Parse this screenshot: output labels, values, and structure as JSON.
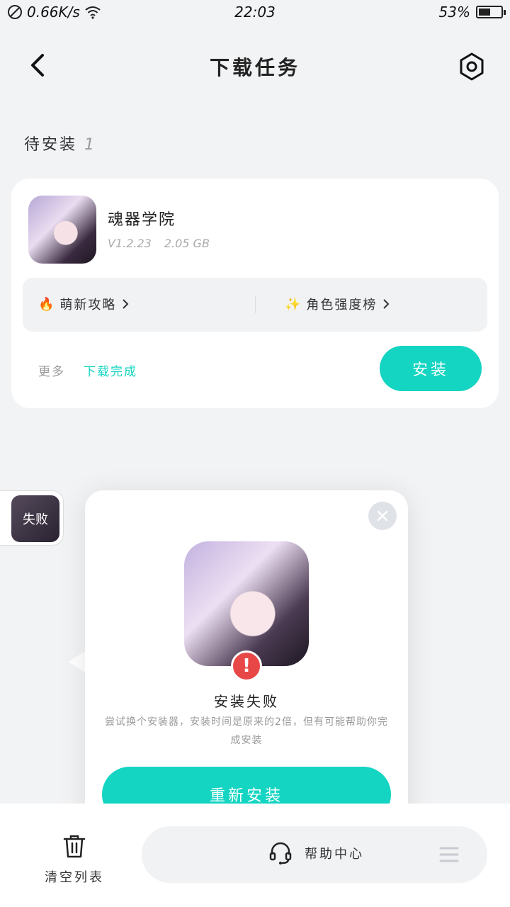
{
  "status_bar": {
    "speed": "0.66K/s",
    "time": "22:03",
    "battery": "53%",
    "battery_level": 0.53
  },
  "header": {
    "title": "下载任务"
  },
  "section": {
    "label": "待安装",
    "count": "1"
  },
  "app_card": {
    "name": "魂器学院",
    "version": "V1.2.23",
    "size": "2.05 GB",
    "link_left": "萌新攻略",
    "link_right": "角色强度榜",
    "link_left_icon": "🔥",
    "link_right_icon": "✨",
    "more_label": "更多",
    "status": "下载完成",
    "install_label": "安装"
  },
  "failed_tab": {
    "label": "失败"
  },
  "popup": {
    "title": "安装失败",
    "description": "尝试换个安装器，安装时间是原来的2倍，但有可能帮助你完成安装",
    "retry_label": "重新安装"
  },
  "bottom_bar": {
    "clear_label": "清空列表",
    "help_label": "帮助中心"
  },
  "colors": {
    "accent": "#14d4c2",
    "error": "#e84747",
    "background": "#f2f3f5"
  }
}
